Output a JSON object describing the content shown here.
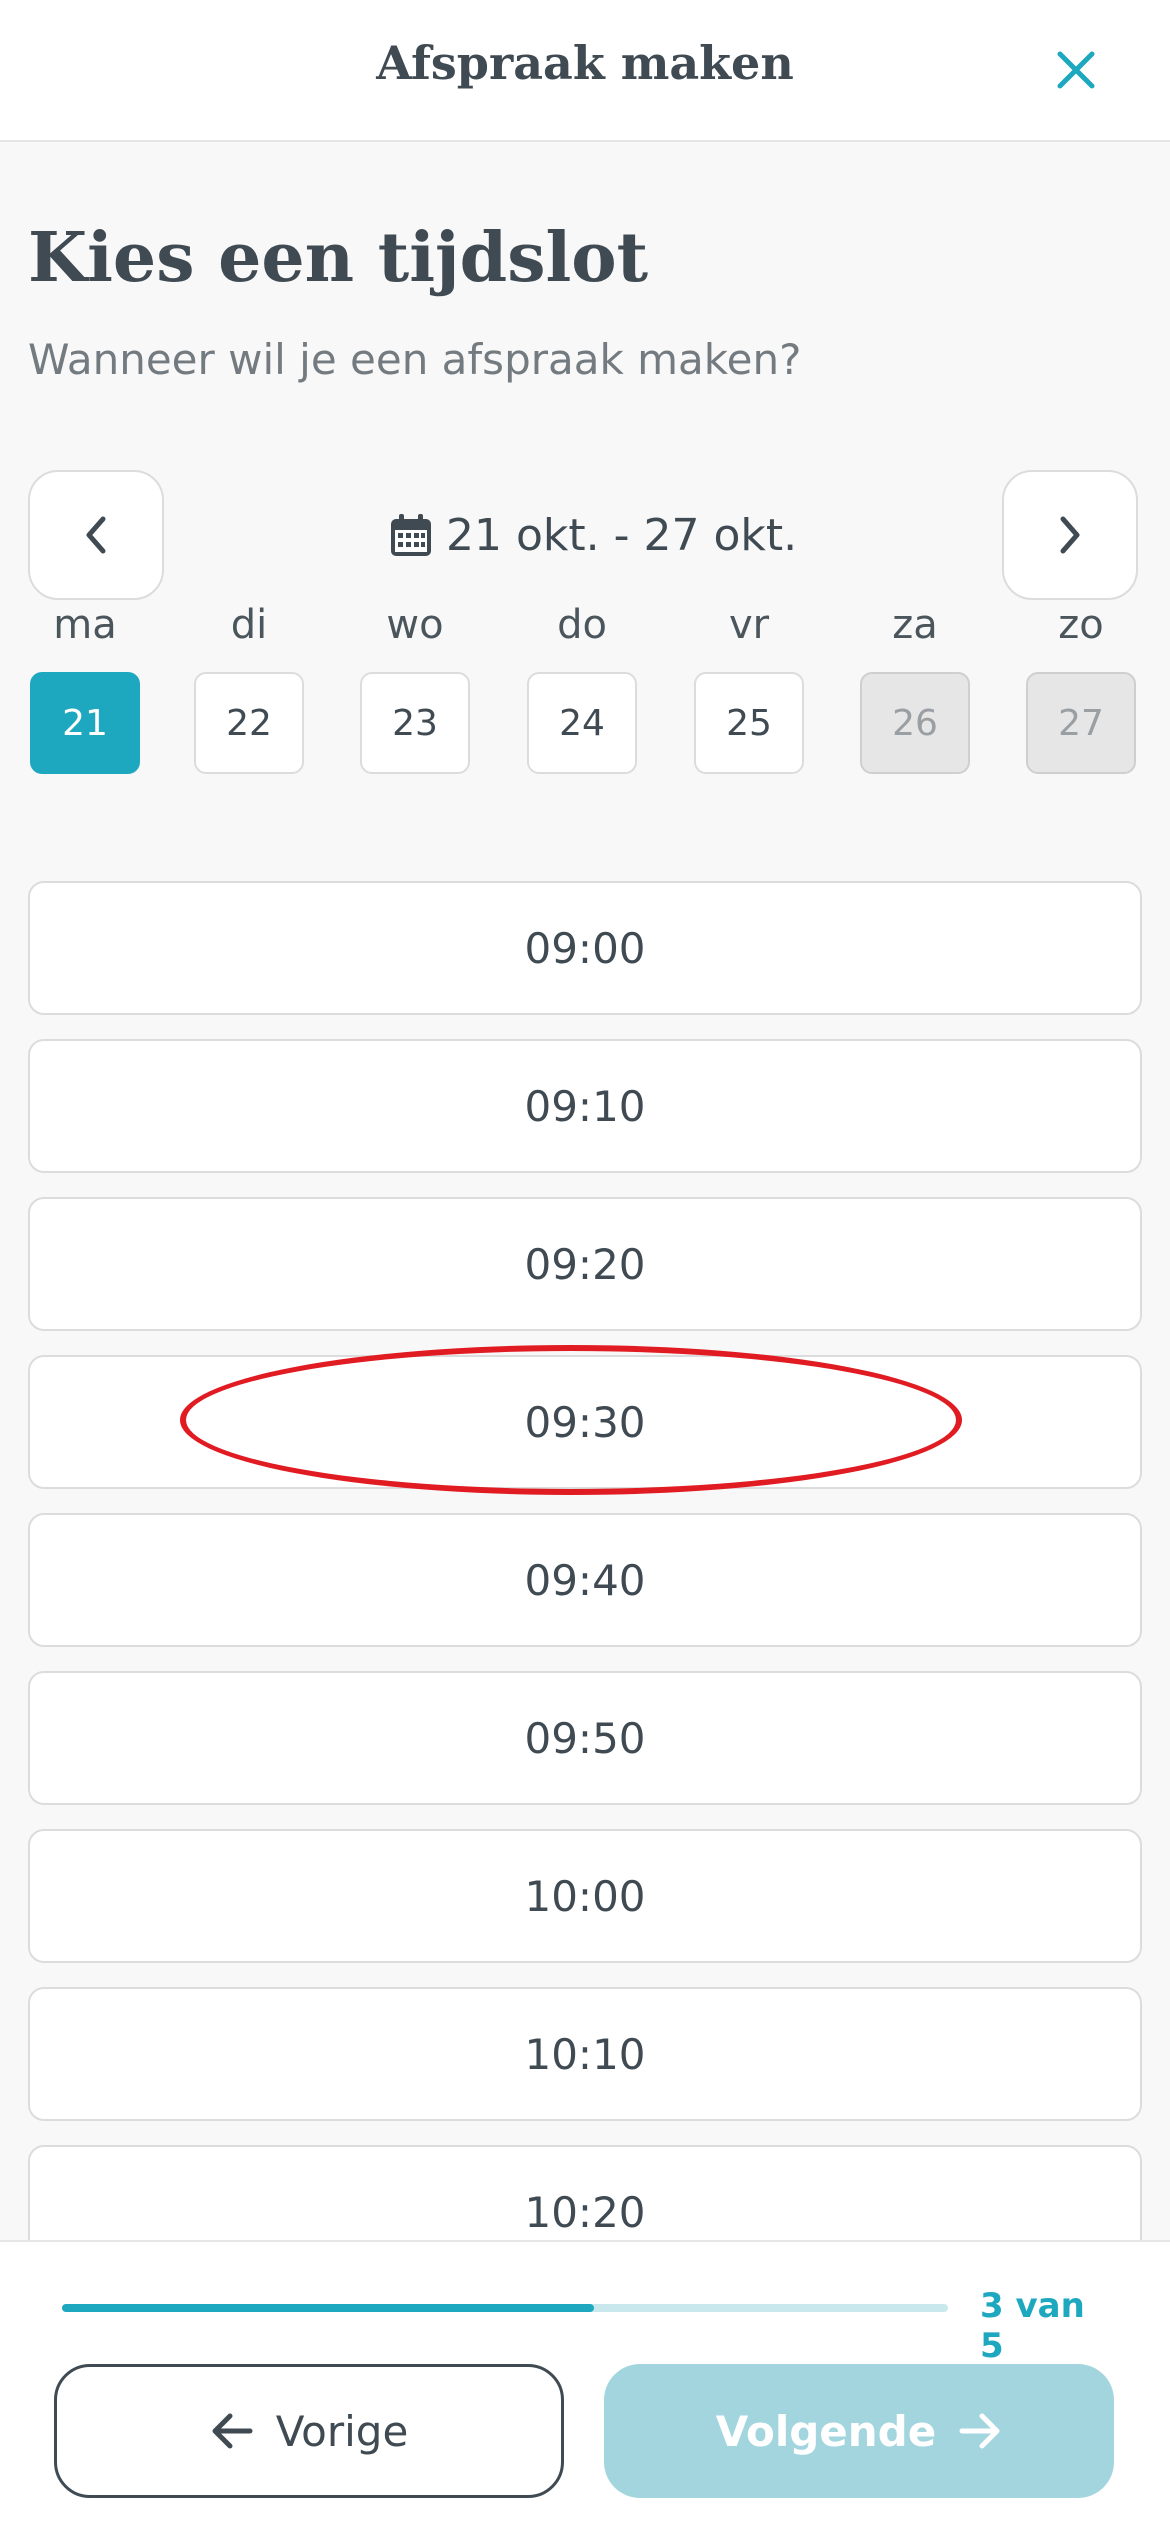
{
  "header": {
    "title": "Afspraak maken",
    "close_icon": "close-icon"
  },
  "page": {
    "heading": "Kies een tijdslot",
    "subheading": "Wanneer wil je een afspraak maken?"
  },
  "week": {
    "range": "21 okt. - 27 okt.",
    "prev_icon": "chevron-left-icon",
    "next_icon": "chevron-right-icon",
    "calendar_icon": "calendar-icon",
    "days": [
      {
        "name": "ma",
        "date": "21",
        "state": "selected"
      },
      {
        "name": "di",
        "date": "22",
        "state": "available"
      },
      {
        "name": "wo",
        "date": "23",
        "state": "available"
      },
      {
        "name": "do",
        "date": "24",
        "state": "available"
      },
      {
        "name": "vr",
        "date": "25",
        "state": "available"
      },
      {
        "name": "za",
        "date": "26",
        "state": "disabled"
      },
      {
        "name": "zo",
        "date": "27",
        "state": "disabled"
      }
    ]
  },
  "slots": [
    "09:00",
    "09:10",
    "09:20",
    "09:30",
    "09:40",
    "09:50",
    "10:00",
    "10:10",
    "10:20"
  ],
  "footer": {
    "progress_fraction": 0.6,
    "progress_label": "3 van 5",
    "prev_label": "Vorige",
    "next_label": "Volgende",
    "prev_icon": "arrow-left-icon",
    "next_icon": "arrow-right-icon"
  },
  "colors": {
    "accent": "#1ea8bf",
    "disabled_button": "#a3d5df",
    "annotation": "#e01b22"
  }
}
